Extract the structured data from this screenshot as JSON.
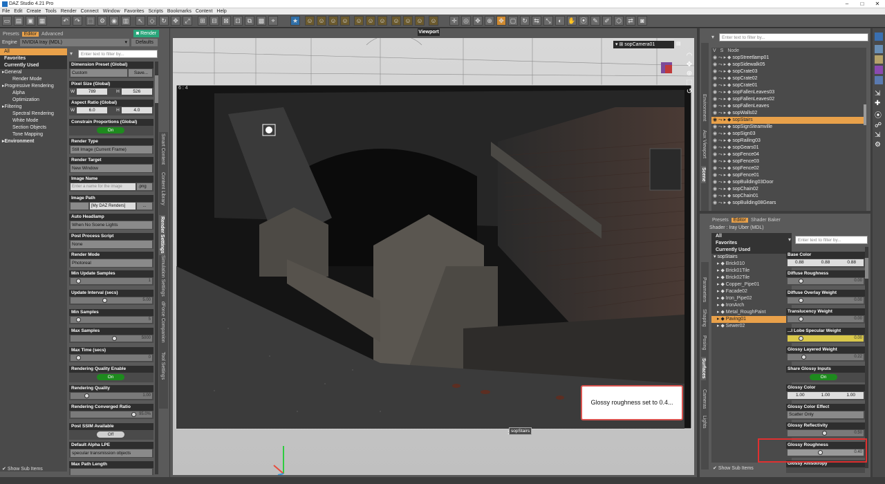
{
  "app": {
    "title": "DAZ Studio 4.21 Pro"
  },
  "menu": [
    "File",
    "Edit",
    "Create",
    "Tools",
    "Render",
    "Connect",
    "Window",
    "Favorites",
    "Scripts",
    "Bookmarks",
    "Content",
    "Help"
  ],
  "left_panel": {
    "tabs": [
      "Presets",
      "Editor",
      "Advanced"
    ],
    "render_button": "Render",
    "engine_label": "Engine",
    "engine_value": "NVIDIA Iray (MDL)",
    "defaults_button": "Defaults",
    "filter_placeholder": "Enter text to filter by...",
    "nav": [
      {
        "label": "All",
        "kind": "sel"
      },
      {
        "label": "Favorites",
        "kind": "head"
      },
      {
        "label": "Currently Used",
        "kind": "head"
      },
      {
        "label": "General",
        "kind": "group"
      },
      {
        "label": "Render Mode",
        "kind": "item"
      },
      {
        "label": "Progressive Rendering",
        "kind": "group"
      },
      {
        "label": "Alpha",
        "kind": "item"
      },
      {
        "label": "Optimization",
        "kind": "item"
      },
      {
        "label": "Filtering",
        "kind": "group"
      },
      {
        "label": "Spectral Rendering",
        "kind": "item"
      },
      {
        "label": "White Mode",
        "kind": "item"
      },
      {
        "label": "Section Objects",
        "kind": "item"
      },
      {
        "label": "Tone Mapping",
        "kind": "item"
      },
      {
        "label": "Environment",
        "kind": "group"
      }
    ],
    "show_sub_items": "Show Sub Items",
    "vtabs": [
      "Smart Content",
      "Content Library",
      "Render Settings",
      "Simulation Settings",
      "dForce Companion",
      "Tool Settings"
    ],
    "props": {
      "dimension": {
        "label": "Dimension Preset (Global)",
        "value": "Custom",
        "button": "Save..."
      },
      "pixel": {
        "label": "Pixel Size (Global)",
        "w_label": "W",
        "w": "789",
        "h_label": "H",
        "h": "526"
      },
      "aspect": {
        "label": "Aspect Ratio (Global)",
        "w_label": "W",
        "w": "6.0",
        "h_label": "H",
        "h": "4.0"
      },
      "constrain": {
        "label": "Constrain Proportions (Global)",
        "value": "On"
      },
      "render_type": {
        "label": "Render Type",
        "value": "Still Image (Current Frame)"
      },
      "render_target": {
        "label": "Render Target",
        "value": "New Window"
      },
      "image_name": {
        "label": "Image Name",
        "placeholder": "Enter a name for the image",
        "ext": ".png"
      },
      "image_path": {
        "label": "Image Path",
        "value": "[My DAZ Renders]",
        "button": "..."
      },
      "auto_headlamp": {
        "label": "Auto Headlamp",
        "value": "When No Scene Lights"
      },
      "post_process": {
        "label": "Post Process Script",
        "value": "None"
      },
      "render_mode": {
        "label": "Render Mode",
        "value": "Photoreal"
      },
      "min_update": {
        "label": "Min Update Samples",
        "value": "1"
      },
      "update_interval": {
        "label": "Update Interval (secs)",
        "value": "5.00"
      },
      "min_samples": {
        "label": "Min Samples",
        "value": "5"
      },
      "max_samples": {
        "label": "Max Samples",
        "value": "5000"
      },
      "max_time": {
        "label": "Max Time (secs)",
        "value": "0"
      },
      "quality_enable": {
        "label": "Rendering Quality Enable",
        "value": "On"
      },
      "quality": {
        "label": "Rendering Quality",
        "value": "1.00"
      },
      "converged": {
        "label": "Rendering Converged Ratio",
        "value": "95.0%"
      },
      "ssim": {
        "label": "Post SSIM Available",
        "value": "Off"
      },
      "alpha_lpe": {
        "label": "Default Alpha LPE",
        "value": "specular transmission objects"
      },
      "max_path": {
        "label": "Max Path Length",
        "value": ""
      }
    }
  },
  "viewport": {
    "tab": "Viewport",
    "camera": "sopCamera01",
    "aspect": "6 : 4",
    "tooltip": "sopStairs",
    "message": "Glossy roughness set to 0.4..."
  },
  "scene_panel": {
    "filter_placeholder": "Enter text to filter by...",
    "headers": [
      "V",
      "S",
      "Node"
    ],
    "vtabs": [
      "Environment",
      "Aux Viewport",
      "Scene"
    ],
    "nodes": [
      "sopStreetlamp01",
      "sopSidewalk05",
      "sopCrate03",
      "sopCrate02",
      "sopCrate01",
      "sopFallenLeaves03",
      "sopFallenLeaves02",
      "sopFallenLeaves",
      "sopWalls02",
      "sopStairs",
      "sopSignSteamville",
      "sopSign03",
      "sopRailing03",
      "sopGears01",
      "sopFence04",
      "sopFence03",
      "sopFence02",
      "sopFence01",
      "sopBuilding03Door",
      "sopChain02",
      "sopChain01",
      "sopBuilding08Gears"
    ],
    "selected": "sopStairs"
  },
  "surfaces_panel": {
    "tabs": [
      "Presets",
      "Editor",
      "Shader Baker"
    ],
    "shader": "Shader : Iray Uber (MDL)",
    "filter_placeholder": "Enter text to filter by...",
    "nav": [
      "All",
      "Favorites",
      "Currently Used"
    ],
    "root": "sopStairs",
    "items": [
      "Brick010",
      "Brick01Tile",
      "Brick02Tile",
      "Copper_Pipe01",
      "Facade02",
      "Iron_Pipe02",
      "IronArch",
      "Metal_RoughPaint",
      "Paving01",
      "Sewer02"
    ],
    "selected": "Paving01",
    "show_sub_items": "Show Sub Items",
    "vtabs": [
      "Parameters",
      "Shaping",
      "Posing",
      "Surfaces",
      "Cameras",
      "Lights"
    ],
    "props": {
      "base_color": {
        "label": "Base Color",
        "r": "0.88",
        "g": "0.88",
        "b": "0.88"
      },
      "diffuse_roughness": {
        "label": "Diffuse Roughness",
        "value": "0.00"
      },
      "diffuse_overlay": {
        "label": "Diffuse Overlay Weight",
        "value": "0.00"
      },
      "translucency": {
        "label": "Translucency Weight",
        "value": "0.00"
      },
      "lobe_specular": {
        "label": "...l Lobe Specular Weight",
        "value": "0.00"
      },
      "glossy_layered": {
        "label": "Glossy Layered Weight",
        "value": "0.22"
      },
      "share_glossy": {
        "label": "Share Glossy Inputs",
        "value": "On"
      },
      "glossy_color": {
        "label": "Glossy Color",
        "r": "1.00",
        "g": "1.00",
        "b": "1.00"
      },
      "glossy_effect": {
        "label": "Glossy Color Effect",
        "value": "Scatter Only"
      },
      "glossy_reflectivity": {
        "label": "Glossy Reflectivity",
        "value": "0.50"
      },
      "glossy_roughness": {
        "label": "Glossy Roughness",
        "value": "0.40"
      },
      "glossy_anisotropy": {
        "label": "Glossy Anisotropy",
        "value": ""
      }
    }
  }
}
